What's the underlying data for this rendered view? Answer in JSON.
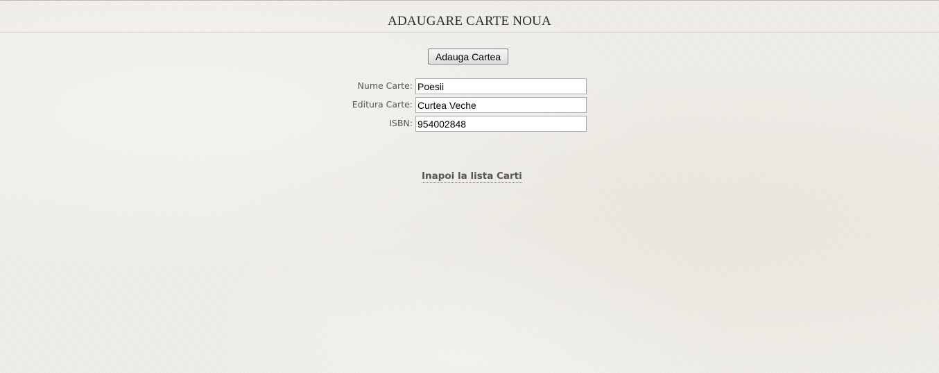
{
  "header": {
    "title": "ADAUGARE CARTE NOUA"
  },
  "form": {
    "submit_label": "Adauga Cartea",
    "fields": [
      {
        "label": "Nume Carte:",
        "value": "Poesii"
      },
      {
        "label": "Editura Carte:",
        "value": "Curtea Veche"
      },
      {
        "label": "ISBN:",
        "value": "954002848"
      }
    ]
  },
  "nav": {
    "back_link": "Inapoi la lista Carti"
  }
}
